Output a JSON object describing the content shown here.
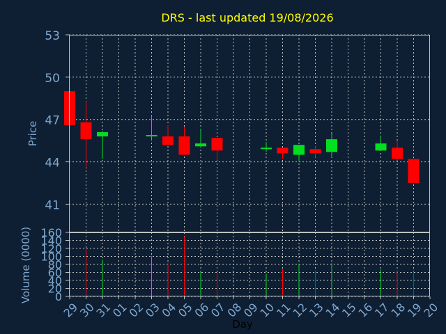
{
  "title": "DRS - last updated 19/08/2026",
  "colors": {
    "background": "#0f1f33",
    "plot_bg": "#0f1f33",
    "border": "#c0c0c0",
    "grid": "#c0c0c0",
    "up": "#00e01f",
    "down": "#ff0000",
    "title": "#ffff00",
    "axis_text": "#7fa8d0",
    "xlabel": "#000000"
  },
  "chart_data": [
    {
      "type": "candlestick",
      "title": "DRS - last updated 19/08/2026",
      "ylabel": "Price",
      "ylim": [
        39,
        53
      ],
      "yticks": [
        41,
        44,
        47,
        50,
        53
      ],
      "grid": true,
      "categories": [
        "29",
        "30",
        "31",
        "01",
        "02",
        "03",
        "04",
        "05",
        "06",
        "07",
        "08",
        "09",
        "10",
        "11",
        "12",
        "13",
        "14",
        "15",
        "16",
        "17",
        "18",
        "19",
        "20"
      ],
      "candles": [
        {
          "x": "29",
          "open": 49.0,
          "high": 49.0,
          "low": 46.6,
          "close": 46.6
        },
        {
          "x": "30",
          "open": 46.8,
          "high": 48.3,
          "low": 43.6,
          "close": 45.6
        },
        {
          "x": "31",
          "open": 45.8,
          "high": 46.2,
          "low": 44.2,
          "close": 46.1
        },
        {
          "x": "03",
          "open": 45.8,
          "high": 47.3,
          "low": 45.5,
          "close": 45.9
        },
        {
          "x": "04",
          "open": 45.8,
          "high": 46.6,
          "low": 45.3,
          "close": 45.2
        },
        {
          "x": "05",
          "open": 45.8,
          "high": 46.5,
          "low": 44.5,
          "close": 44.5
        },
        {
          "x": "06",
          "open": 45.1,
          "high": 46.3,
          "low": 45.0,
          "close": 45.3
        },
        {
          "x": "07",
          "open": 45.7,
          "high": 45.7,
          "low": 44.1,
          "close": 44.8
        },
        {
          "x": "10",
          "open": 44.9,
          "high": 45.4,
          "low": 44.7,
          "close": 45.0
        },
        {
          "x": "11",
          "open": 45.0,
          "high": 45.0,
          "low": 44.2,
          "close": 44.6
        },
        {
          "x": "12",
          "open": 44.5,
          "high": 45.2,
          "low": 44.0,
          "close": 45.2
        },
        {
          "x": "13",
          "open": 44.9,
          "high": 45.1,
          "low": 44.3,
          "close": 44.6
        },
        {
          "x": "14",
          "open": 44.7,
          "high": 46.0,
          "low": 44.4,
          "close": 45.6
        },
        {
          "x": "17",
          "open": 44.8,
          "high": 45.8,
          "low": 44.8,
          "close": 45.3
        },
        {
          "x": "18",
          "open": 45.0,
          "high": 45.5,
          "low": 44.1,
          "close": 44.2
        },
        {
          "x": "19",
          "open": 44.2,
          "high": 44.2,
          "low": 42.5,
          "close": 42.5
        }
      ]
    },
    {
      "type": "bar",
      "ylabel": "Volume (0000)",
      "xlabel": "Day",
      "ylim": [
        0,
        160
      ],
      "yticks": [
        0,
        20,
        40,
        60,
        80,
        100,
        120,
        140,
        160
      ],
      "grid": true,
      "categories": [
        "29",
        "30",
        "31",
        "01",
        "02",
        "03",
        "04",
        "05",
        "06",
        "07",
        "08",
        "09",
        "10",
        "11",
        "12",
        "13",
        "14",
        "15",
        "16",
        "17",
        "18",
        "19",
        "20"
      ],
      "bars": [
        {
          "x": "30",
          "value": 118,
          "direction": "down"
        },
        {
          "x": "31",
          "value": 92,
          "direction": "up"
        },
        {
          "x": "03",
          "value": 100,
          "direction": "up"
        },
        {
          "x": "04",
          "value": 83,
          "direction": "down"
        },
        {
          "x": "05",
          "value": 150,
          "direction": "down"
        },
        {
          "x": "06",
          "value": 63,
          "direction": "up"
        },
        {
          "x": "07",
          "value": 60,
          "direction": "down"
        },
        {
          "x": "10",
          "value": 57,
          "direction": "up"
        },
        {
          "x": "11",
          "value": 68,
          "direction": "down"
        },
        {
          "x": "12",
          "value": 80,
          "direction": "up"
        },
        {
          "x": "13",
          "value": 65,
          "direction": "down"
        },
        {
          "x": "14",
          "value": 83,
          "direction": "up"
        },
        {
          "x": "17",
          "value": 67,
          "direction": "up"
        },
        {
          "x": "18",
          "value": 63,
          "direction": "down"
        },
        {
          "x": "19",
          "value": 63,
          "direction": "down"
        }
      ]
    }
  ]
}
